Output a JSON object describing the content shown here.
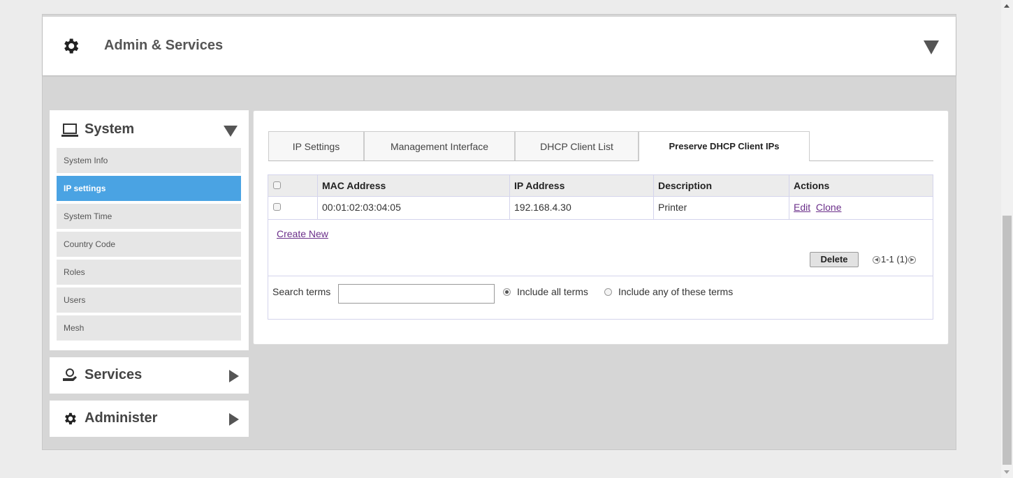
{
  "header": {
    "title": "Admin & Services"
  },
  "sidebar": {
    "system": {
      "label": "System",
      "items": [
        {
          "label": "System Info"
        },
        {
          "label": "IP settings"
        },
        {
          "label": "System Time"
        },
        {
          "label": "Country Code"
        },
        {
          "label": "Roles"
        },
        {
          "label": "Users"
        },
        {
          "label": "Mesh"
        }
      ],
      "active_item": "IP settings"
    },
    "services": {
      "label": "Services"
    },
    "administer": {
      "label": "Administer"
    }
  },
  "tabs": [
    {
      "label": "IP Settings"
    },
    {
      "label": "Management Interface"
    },
    {
      "label": "DHCP Client List"
    },
    {
      "label": "Preserve DHCP Client IPs"
    }
  ],
  "active_tab": "Preserve DHCP Client IPs",
  "table": {
    "columns": [
      "MAC Address",
      "IP Address",
      "Description",
      "Actions"
    ],
    "rows": [
      {
        "mac": "00:01:02:03:04:05",
        "ip": "192.168.4.30",
        "description": "Printer",
        "actions": [
          "Edit",
          "Clone"
        ]
      }
    ],
    "create_new": "Create New",
    "delete_label": "Delete",
    "pager": "1-1 (1)"
  },
  "search": {
    "label": "Search terms",
    "value": "",
    "option_all": "Include all terms",
    "option_any": "Include any of these terms",
    "selected": "Include all terms"
  },
  "colors": {
    "active_item_bg": "#4aa3e3",
    "link": "#6b2f8a",
    "page_bg": "#d6d6d6"
  }
}
